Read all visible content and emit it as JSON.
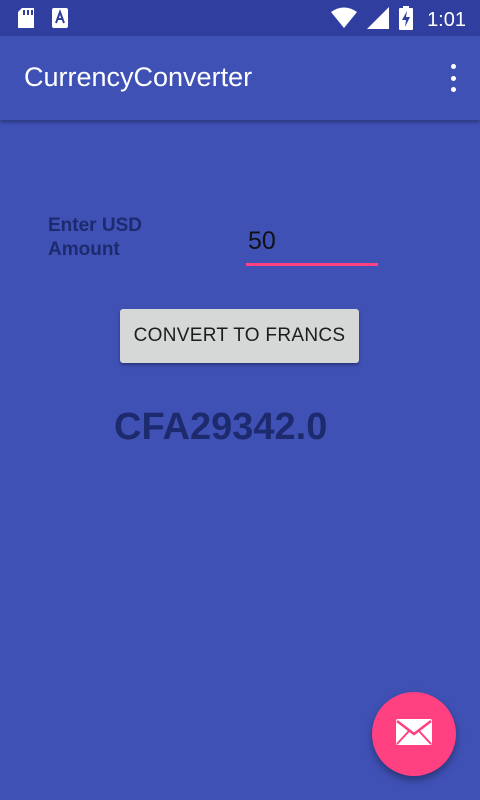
{
  "status_bar": {
    "time": "1:01",
    "icons": [
      "sd-card-icon",
      "a-notification-icon",
      "wifi-icon",
      "signal-icon",
      "battery-charging-icon"
    ]
  },
  "app_bar": {
    "title": "CurrencyConverter",
    "menu_icon": "overflow-menu-icon"
  },
  "form": {
    "label": "Enter USD Amount",
    "amount_value": "50",
    "button_label": "CONVERT TO FRANCS"
  },
  "result": {
    "text": "CFA29342.0"
  },
  "fab": {
    "icon": "email-icon"
  },
  "colors": {
    "primary": "#3F51B5",
    "primary_dark": "#303F9F",
    "accent": "#FF4081",
    "text_dark": "#1E2A6E"
  }
}
